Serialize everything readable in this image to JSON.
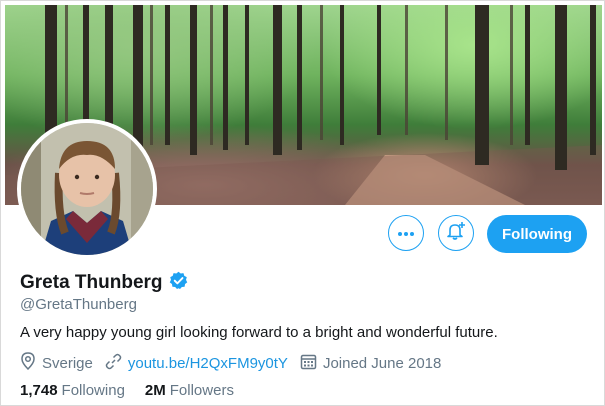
{
  "profile": {
    "name": "Greta Thunberg",
    "verified": true,
    "handle": "@GretaThunberg",
    "bio": "A very happy young girl looking forward to a bright and wonderful future.",
    "location": "Sverige",
    "website": "youtu.be/H2QxFM9y0tY",
    "joined": "Joined June 2018"
  },
  "stats": {
    "following_count": "1,748",
    "following_label": "Following",
    "followers_count": "2M",
    "followers_label": "Followers"
  },
  "actions": {
    "follow_label": "Following"
  },
  "icons": {
    "more": "more-icon",
    "notifications": "bell-plus-icon",
    "location": "location-pin-icon",
    "link": "link-icon",
    "calendar": "calendar-icon",
    "verified": "verified-badge-icon"
  },
  "colors": {
    "accent": "#1da1f2",
    "link": "#1b95e0",
    "secondary_text": "#657786"
  }
}
